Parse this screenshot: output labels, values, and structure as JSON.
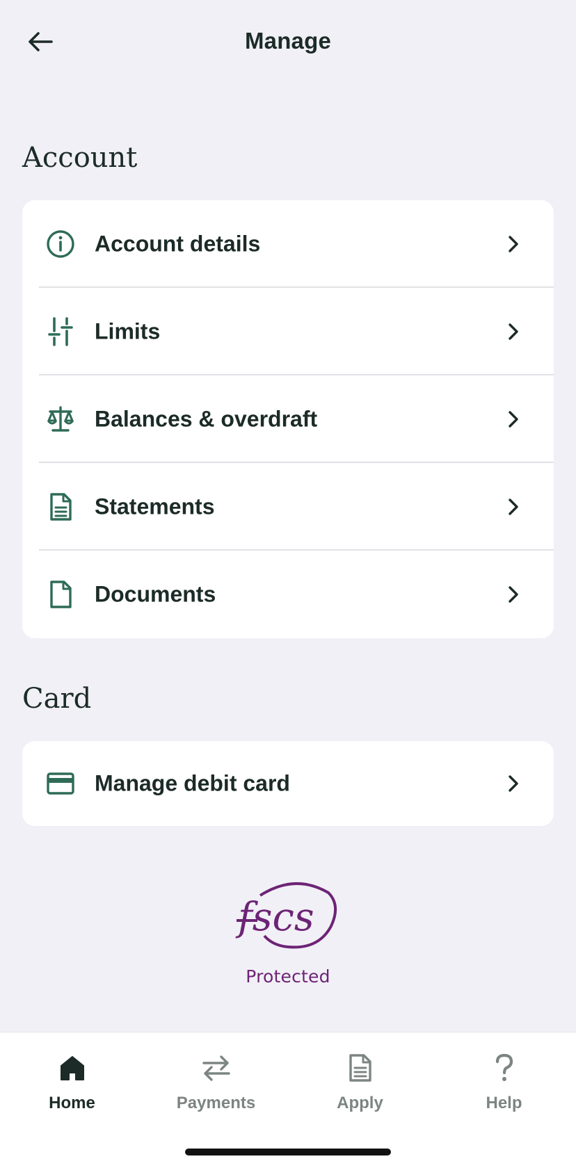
{
  "header": {
    "title": "Manage",
    "back_icon": "arrow-left-icon"
  },
  "colors": {
    "background": "#f1f0f6",
    "accent_green": "#2e6b57",
    "text_dark": "#1c2b27",
    "fscs_purple": "#6d2475",
    "tab_inactive": "#7c8581"
  },
  "account_section": {
    "heading": "Account",
    "items": [
      {
        "label": "Account details",
        "icon": "info-icon"
      },
      {
        "label": "Limits",
        "icon": "sliders-icon"
      },
      {
        "label": "Balances & overdraft",
        "icon": "scales-icon"
      },
      {
        "label": "Statements",
        "icon": "statement-icon"
      },
      {
        "label": "Documents",
        "icon": "document-icon"
      }
    ]
  },
  "card_section": {
    "heading": "Card",
    "items": [
      {
        "label": "Manage debit card",
        "icon": "credit-card-icon"
      }
    ]
  },
  "fscs": {
    "logo_text": "fscs",
    "caption": "Protected"
  },
  "tabbar": {
    "tabs": [
      {
        "label": "Home",
        "icon": "home-icon",
        "active": true
      },
      {
        "label": "Payments",
        "icon": "transfer-arrows-icon",
        "active": false
      },
      {
        "label": "Apply",
        "icon": "document-icon",
        "active": false
      },
      {
        "label": "Help",
        "icon": "question-mark-icon",
        "active": false
      }
    ]
  }
}
